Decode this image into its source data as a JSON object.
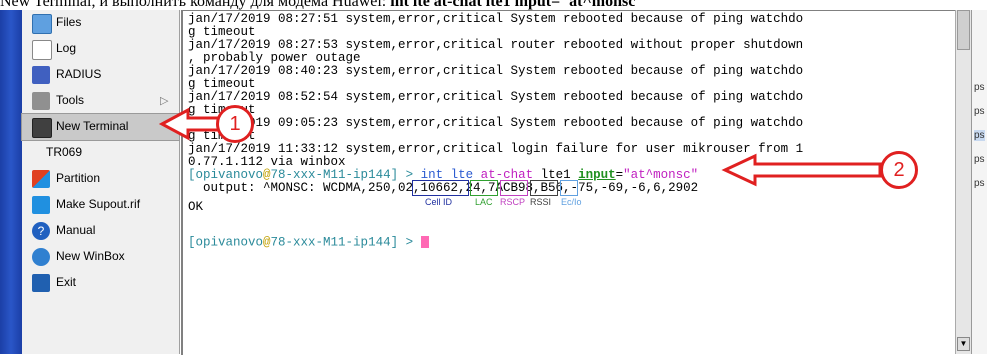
{
  "caption": {
    "pre": "New Terminal, и выполнить команду для модема Huawei:",
    "bold": "int lte at-chat lte1 input=\"at^monsc\""
  },
  "menu": [
    {
      "label": "Files",
      "icon": "folder-icon",
      "color": "#5fa0e0"
    },
    {
      "label": "Log",
      "icon": "log-icon",
      "color": "#ffffff"
    },
    {
      "label": "RADIUS",
      "icon": "radius-icon",
      "color": "#4060c0"
    },
    {
      "label": "Tools",
      "icon": "tools-icon",
      "color": "#808080"
    },
    {
      "label": "New Terminal",
      "icon": "terminal-icon",
      "color": "#404040"
    },
    {
      "label": "TR069",
      "icon": "",
      "color": ""
    },
    {
      "label": "Partition",
      "icon": "partition-icon",
      "color": "#e04020"
    },
    {
      "label": "Make Supout.rif",
      "icon": "supout-icon",
      "color": "#2090e0"
    },
    {
      "label": "Manual",
      "icon": "help-icon",
      "color": "#2060c0"
    },
    {
      "label": "New WinBox",
      "icon": "winbox-icon",
      "color": "#3080d0"
    },
    {
      "label": "Exit",
      "icon": "exit-icon",
      "color": "#2060b0"
    }
  ],
  "terminal": {
    "lines": [
      "jan/17/2019 08:27:51 system,error,critical System rebooted because of ping watchdo",
      "g timeout",
      "jan/17/2019 08:27:53 system,error,critical router rebooted without proper shutdown",
      ", probably power outage",
      "jan/17/2019 08:40:23 system,error,critical System rebooted because of ping watchdo",
      "g timeout",
      "jan/17/2019 08:52:54 system,error,critical System rebooted because of ping watchdo",
      "g timeout",
      "jan/17/2019 09:05:23 system,error,critical System rebooted because of ping watchdo",
      "g timeout",
      "jan/17/2019 11:33:12 system,error,critical login failure for user mikrouser from 1",
      "0.77.1.112 via winbox"
    ],
    "prompt_user": "opivanovo",
    "prompt_at": "@",
    "prompt_host": "78-xxx-M11-ip144",
    "prompt_open": "[",
    "prompt_close": "] > ",
    "cmd_1": "int lte ",
    "cmd_atchat": "at-chat",
    "cmd_2": " lte1 ",
    "cmd_input": "input",
    "cmd_eq": "=",
    "cmd_val": "\"at^monsc\"",
    "output_line": "  output: ^MONSC: WCDMA,250,02,10662,24,7ACB98,B56,-75,-69,-6,6,2902",
    "ok_line": "OK"
  },
  "annotations": {
    "labels": [
      "Cell ID",
      "LAC",
      "RSCP",
      "RSSI",
      "Ec/Io"
    ],
    "circle_1": "1",
    "circle_2": "2"
  },
  "rightpane": [
    "ps",
    "ps",
    "ps",
    "ps",
    "ps"
  ]
}
